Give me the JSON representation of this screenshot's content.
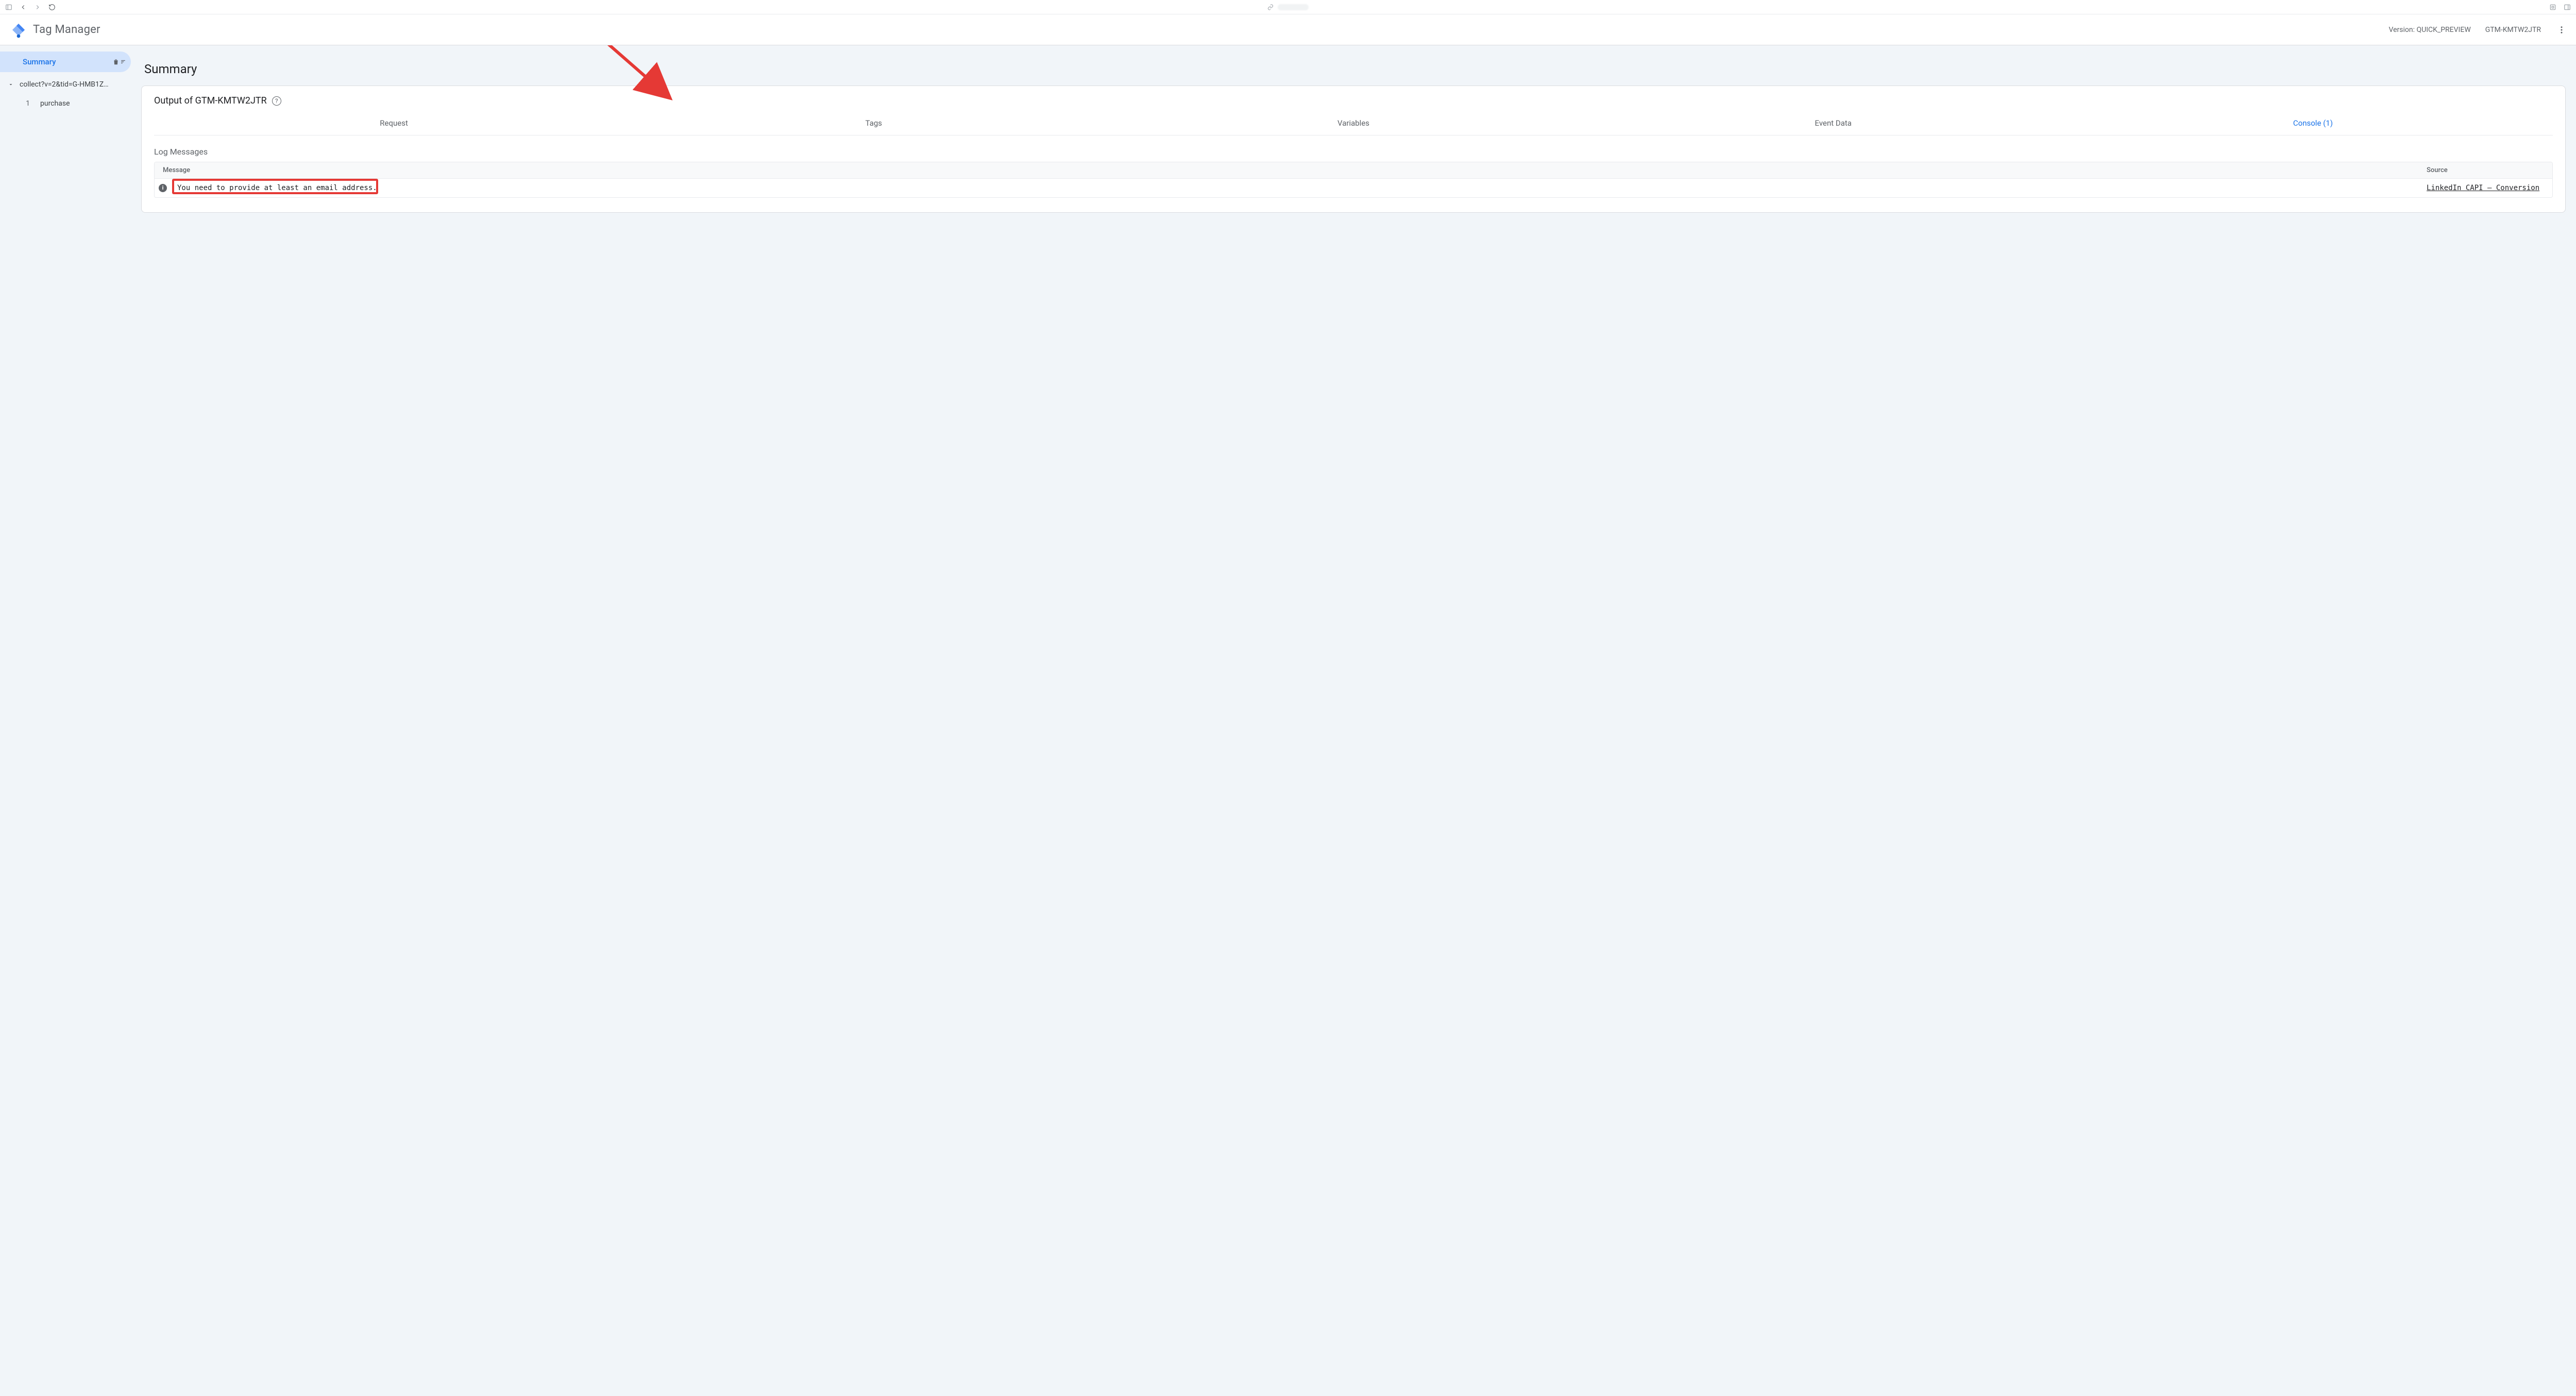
{
  "header": {
    "app_title": "Tag Manager",
    "version_label": "Version: QUICK_PREVIEW",
    "container_id": "GTM-KMTW2JTR"
  },
  "sidebar": {
    "summary_label": "Summary",
    "request": {
      "label": "collect?v=2&tid=G-HMB1Z…",
      "events": [
        {
          "index": "1",
          "name": "purchase"
        }
      ]
    }
  },
  "main": {
    "page_title": "Summary",
    "output_prefix": "Output of ",
    "output_container": "GTM-KMTW2JTR",
    "tabs": {
      "request": "Request",
      "tags": "Tags",
      "variables": "Variables",
      "event_data": "Event Data",
      "console": "Console (1)"
    },
    "log": {
      "section_title": "Log Messages",
      "col_message": "Message",
      "col_source": "Source",
      "rows": [
        {
          "level": "i",
          "message": "You need to provide at least an email address.",
          "source": "LinkedIn CAPI – Conversion"
        }
      ]
    }
  },
  "annotation": {
    "highlight_color": "#e53935"
  }
}
